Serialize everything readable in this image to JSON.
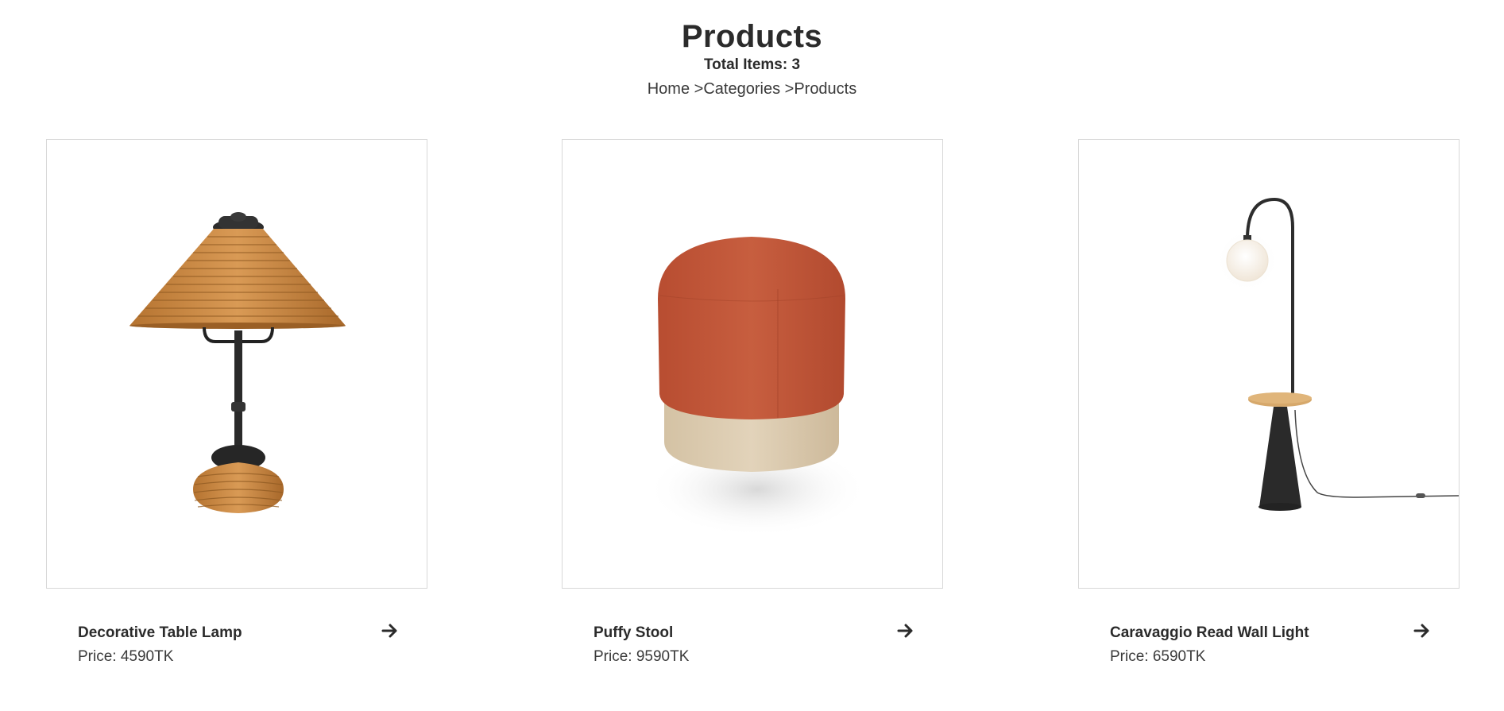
{
  "header": {
    "title": "Products",
    "total_items": "Total Items: 3"
  },
  "breadcrumb": {
    "home": "Home",
    "separator_1": " >",
    "categories": "Categories",
    "separator_2": " >",
    "current": "Products"
  },
  "products": [
    {
      "name": "Decorative Table Lamp",
      "price": "Price: 4590TK",
      "image_icon": "table-lamp-image",
      "arrow_icon": "arrow-right-icon"
    },
    {
      "name": "Puffy Stool",
      "price": "Price: 9590TK",
      "image_icon": "stool-image",
      "arrow_icon": "arrow-right-icon"
    },
    {
      "name": "Caravaggio Read Wall Light",
      "price": "Price: 6590TK",
      "image_icon": "floor-lamp-image",
      "arrow_icon": "arrow-right-icon"
    }
  ],
  "colors": {
    "text": "#2b2b2b",
    "border": "#d8d8d8",
    "background": "#ffffff",
    "rattan": "#c98a42",
    "stool_top": "#c2583a",
    "stool_base": "#dccbb0"
  }
}
